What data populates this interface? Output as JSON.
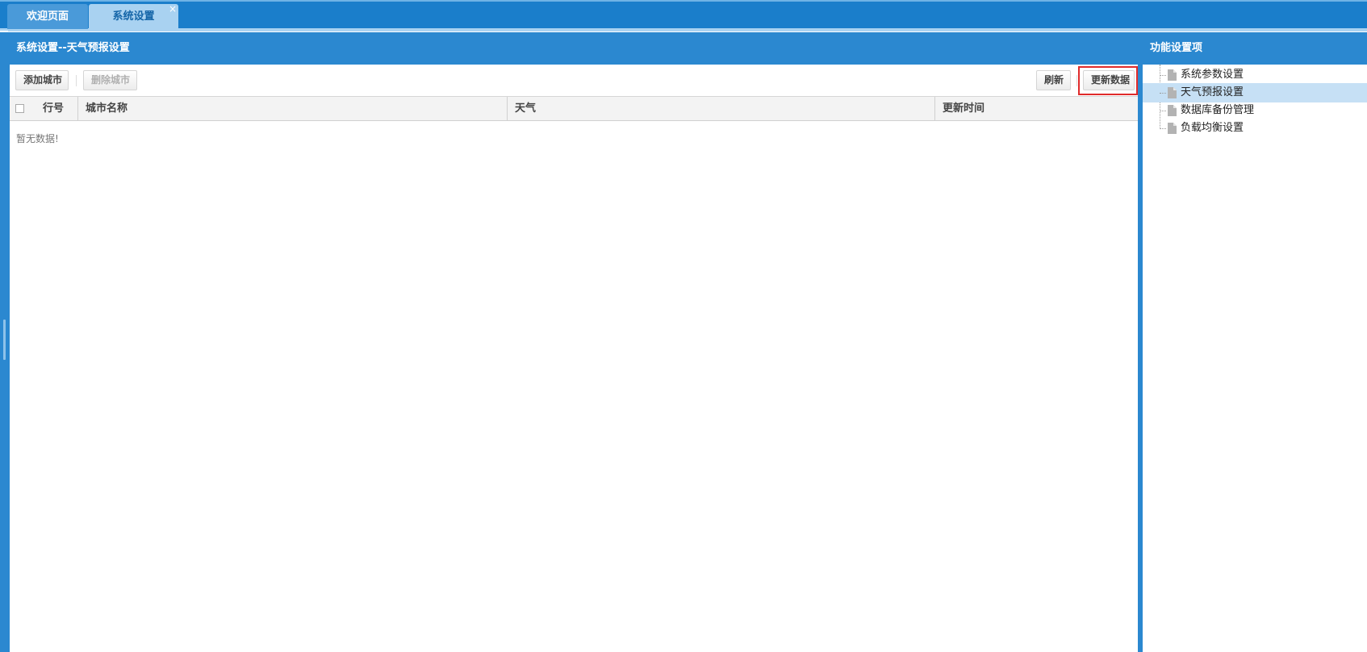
{
  "tabs": {
    "welcome": "欢迎页面",
    "settings": "系统设置",
    "close_glyph": "×"
  },
  "main": {
    "title": "系统设置--天气预报设置",
    "toolbar": {
      "add_label": "添加城市",
      "delete_label": "删除城市",
      "refresh_label": "刷新",
      "update_label": "更新数据"
    },
    "grid": {
      "columns": [
        "行号",
        "城市名称",
        "天气",
        "更新时间"
      ],
      "rows": [],
      "empty_text": "暂无数据!"
    }
  },
  "side": {
    "title": "功能设置项",
    "items": [
      {
        "label": "系统参数设置",
        "selected": false,
        "icon": "document-icon"
      },
      {
        "label": "天气预报设置",
        "selected": true,
        "icon": "document-icon"
      },
      {
        "label": "数据库备份管理",
        "selected": false,
        "icon": "document-icon"
      },
      {
        "label": "负载均衡设置",
        "selected": false,
        "icon": "document-icon"
      }
    ]
  },
  "colors": {
    "header_blue": "#2b88d0",
    "tab_active": "#a9d2f1",
    "selected_row": "#c6e0f5",
    "highlight_red": "#e02b2b"
  }
}
